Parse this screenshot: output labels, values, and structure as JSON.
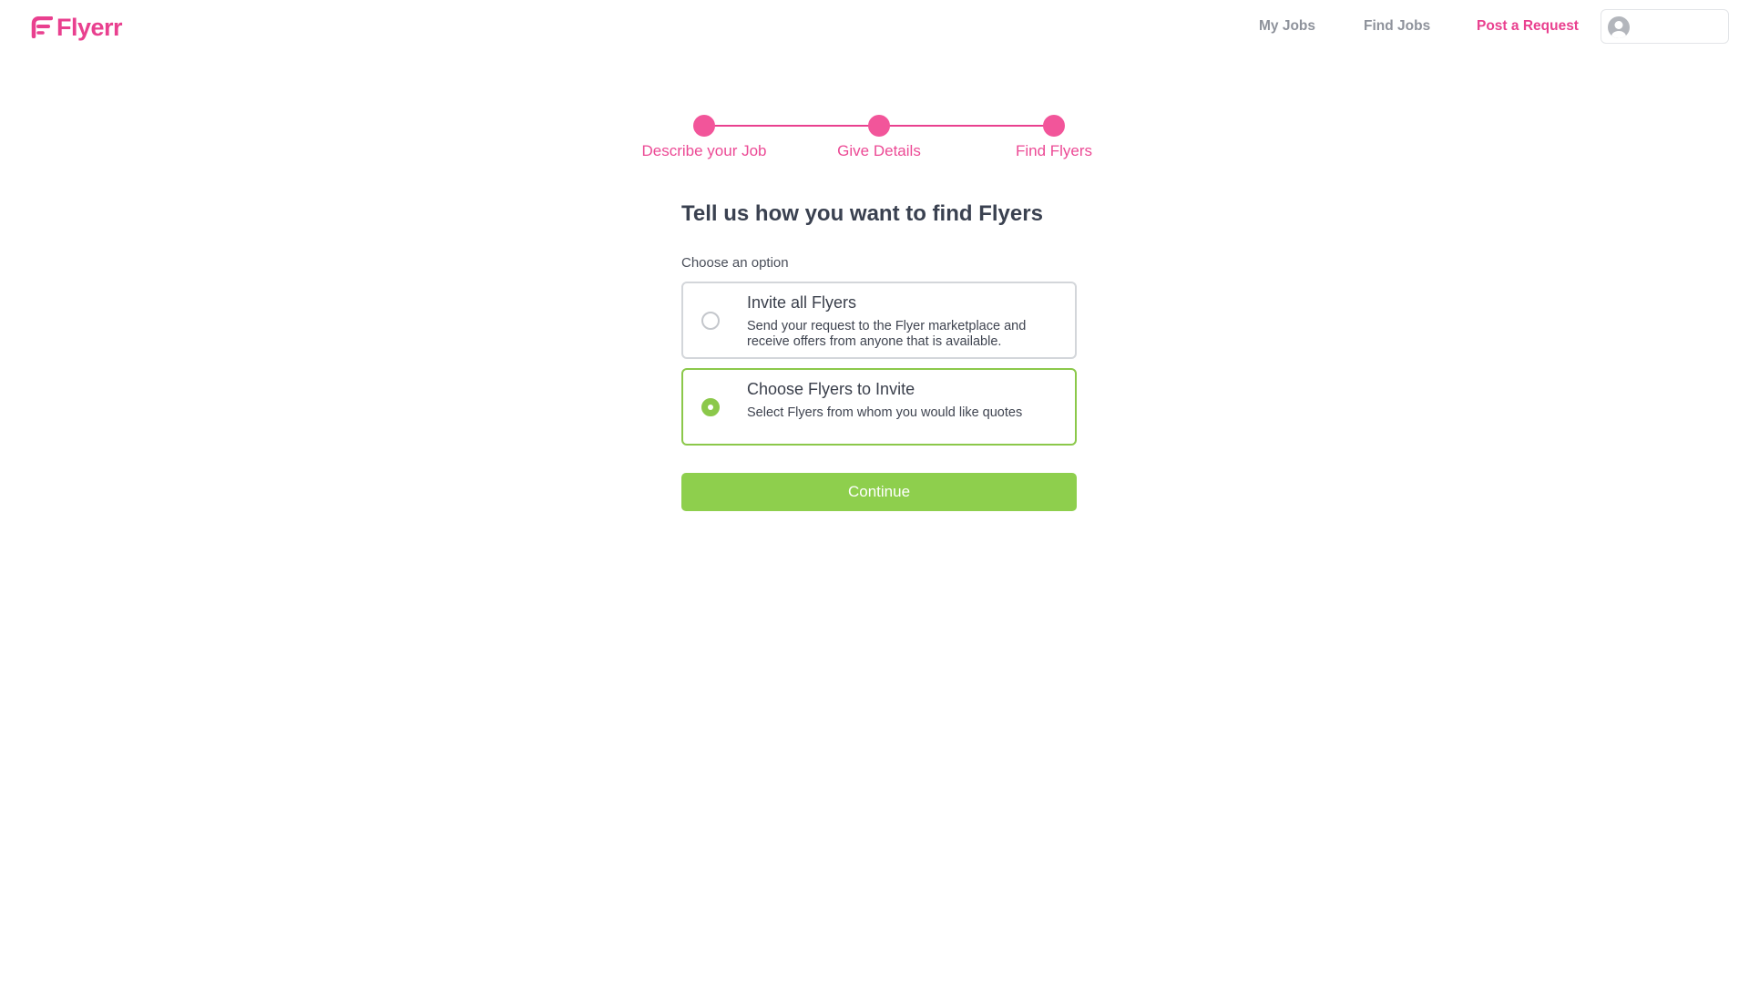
{
  "header": {
    "logo_text": "Flyerr",
    "brand_color": "#e9408f",
    "nav": [
      {
        "label": "My Jobs",
        "accent": false
      },
      {
        "label": "Find Jobs",
        "accent": false
      },
      {
        "label": "Post a Request",
        "accent": true
      }
    ],
    "user_menu_icon": "user-avatar-icon"
  },
  "stepper": {
    "steps": [
      {
        "label": "Describe your Job",
        "state": "complete"
      },
      {
        "label": "Give Details",
        "state": "complete"
      },
      {
        "label": "Find Flyers",
        "state": "current"
      }
    ]
  },
  "main": {
    "title": "Tell us how you want to find Flyers",
    "choose_label": "Choose an option",
    "options": [
      {
        "title": "Invite all Flyers",
        "description": "Send your request to the Flyer marketplace and receive offers from anyone that is available.",
        "selected": false
      },
      {
        "title": "Choose Flyers to Invite",
        "description": "Select Flyers from whom you would like quotes",
        "selected": true
      }
    ],
    "continue_label": "Continue",
    "accent_color": "#8ecf4d"
  }
}
